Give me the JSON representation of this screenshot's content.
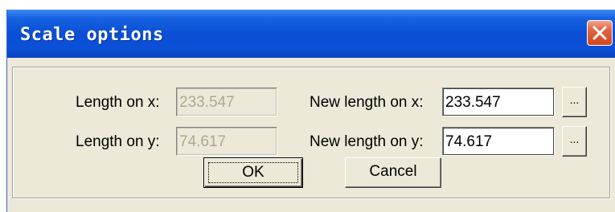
{
  "window": {
    "title": "Scale options"
  },
  "fields": {
    "length_x_label": "Length on x:",
    "length_x_value": "233.547",
    "length_y_label": "Length on y:",
    "length_y_value": "74.617",
    "new_length_x_label": "New length on x:",
    "new_length_x_value": "233.547",
    "new_length_y_label": "New length on y:",
    "new_length_y_value": "74.617"
  },
  "buttons": {
    "browse_label": "...",
    "ok_label": "OK",
    "cancel_label": "Cancel"
  },
  "icons": {
    "close": "close-icon"
  },
  "colors": {
    "titlebar": "#0a4fd6",
    "dialog_bg": "#ece9d8",
    "close_button": "#e0613e"
  }
}
